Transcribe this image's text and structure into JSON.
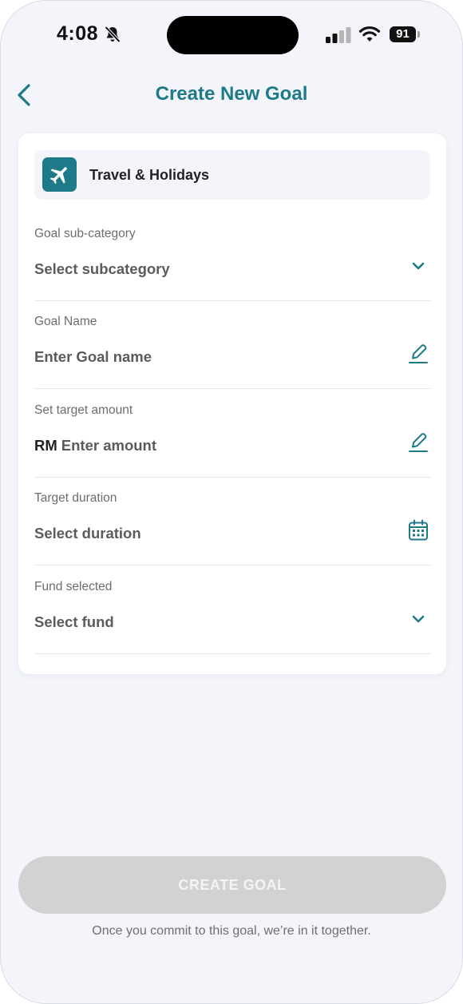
{
  "status_bar": {
    "time": "4:08",
    "battery": "91"
  },
  "header": {
    "title": "Create New Goal"
  },
  "category": {
    "label": "Travel & Holidays",
    "icon": "airplane-icon"
  },
  "fields": {
    "subcategory": {
      "label": "Goal sub-category",
      "value": "Select subcategory",
      "icon": "chevron-down-icon"
    },
    "goal_name": {
      "label": "Goal Name",
      "value": "Enter Goal name",
      "icon": "pencil-icon"
    },
    "target_amount": {
      "label": "Set target amount",
      "prefix": "RM",
      "value": "Enter amount",
      "icon": "pencil-icon"
    },
    "duration": {
      "label": "Target duration",
      "value": "Select duration",
      "icon": "calendar-icon"
    },
    "fund": {
      "label": "Fund selected",
      "value": "Select fund",
      "icon": "chevron-down-icon"
    }
  },
  "footer": {
    "button_label": "CREATE GOAL",
    "note": "Once you commit to this goal, we’re in it together."
  },
  "colors": {
    "accent": "#1d7a88",
    "background": "#f3f5fb",
    "button_disabled": "#d2d2d2"
  }
}
